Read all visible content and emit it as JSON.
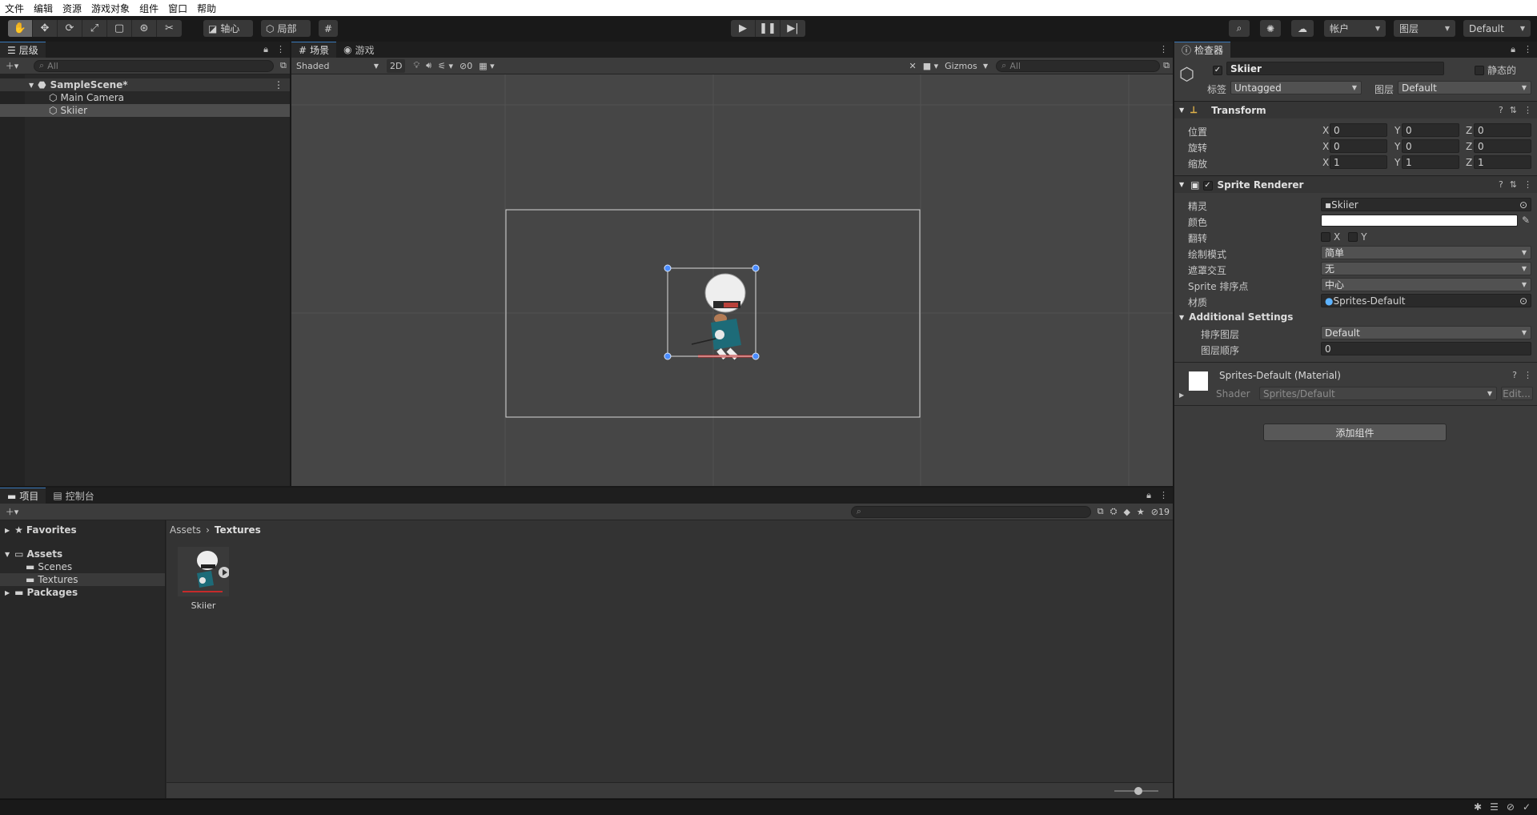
{
  "menu": [
    "文件",
    "编辑",
    "资源",
    "游戏对象",
    "组件",
    "窗口",
    "帮助"
  ],
  "toolbar": {
    "tools": [
      "hand-tool-icon",
      "move-tool-icon",
      "rotate-tool-icon",
      "scale-tool-icon",
      "rect-tool-icon",
      "transform-tool-icon",
      "custom-tool-icon"
    ],
    "pivot_label": "轴心",
    "local_label": "局部",
    "account_label": "帐户",
    "layers_label": "图层",
    "layout_label": "Default"
  },
  "hierarchy": {
    "tab": "层级",
    "search_placeholder": "All",
    "scene": "SampleScene*",
    "objects": [
      "Main Camera",
      "Skiier"
    ]
  },
  "scene": {
    "tabs": [
      "场景",
      "游戏"
    ],
    "shading_mode": "Shaded",
    "toggle_2d": "2D",
    "hidden_count": "0",
    "gizmos_label": "Gizmos",
    "search_placeholder": "All"
  },
  "project": {
    "tabs": [
      "项目",
      "控制台"
    ],
    "hidden_count": "19",
    "tree": {
      "favorites": "Favorites",
      "assets": "Assets",
      "scenes": "Scenes",
      "textures": "Textures",
      "packages": "Packages"
    },
    "breadcrumb": [
      "Assets",
      "Textures"
    ],
    "assets": [
      {
        "name": "Skiier"
      }
    ]
  },
  "inspector": {
    "tab": "检查器",
    "object_name": "Skiier",
    "static_label": "静态的",
    "tag_label": "标签",
    "tag_value": "Untagged",
    "layer_label": "图层",
    "layer_value": "Default",
    "transform": {
      "title": "Transform",
      "rows": [
        {
          "label": "位置",
          "x": "0",
          "y": "0",
          "z": "0"
        },
        {
          "label": "旋转",
          "x": "0",
          "y": "0",
          "z": "0"
        },
        {
          "label": "缩放",
          "x": "1",
          "y": "1",
          "z": "1"
        }
      ]
    },
    "sprite_renderer": {
      "title": "Sprite Renderer",
      "sprite_label": "精灵",
      "sprite_value": "Skiier",
      "color_label": "颜色",
      "color_value": "#ffffff",
      "flip_label": "翻转",
      "flip_x": "X",
      "flip_y": "Y",
      "draw_mode_label": "绘制模式",
      "draw_mode_value": "简单",
      "mask_label": "遮罩交互",
      "mask_value": "无",
      "sort_point_label": "Sprite 排序点",
      "sort_point_value": "中心",
      "material_label": "材质",
      "material_value": "Sprites-Default",
      "additional_title": "Additional Settings",
      "sorting_layer_label": "排序图层",
      "sorting_layer_value": "Default",
      "order_label": "图层顺序",
      "order_value": "0"
    },
    "material": {
      "title": "Sprites-Default (Material)",
      "shader_label": "Shader",
      "shader_value": "Sprites/Default",
      "edit_label": "Edit..."
    },
    "add_component": "添加组件"
  },
  "colors": {
    "accent": "#3a79bb",
    "selection": "#4d4d4d",
    "handle": "#4a8cff"
  }
}
